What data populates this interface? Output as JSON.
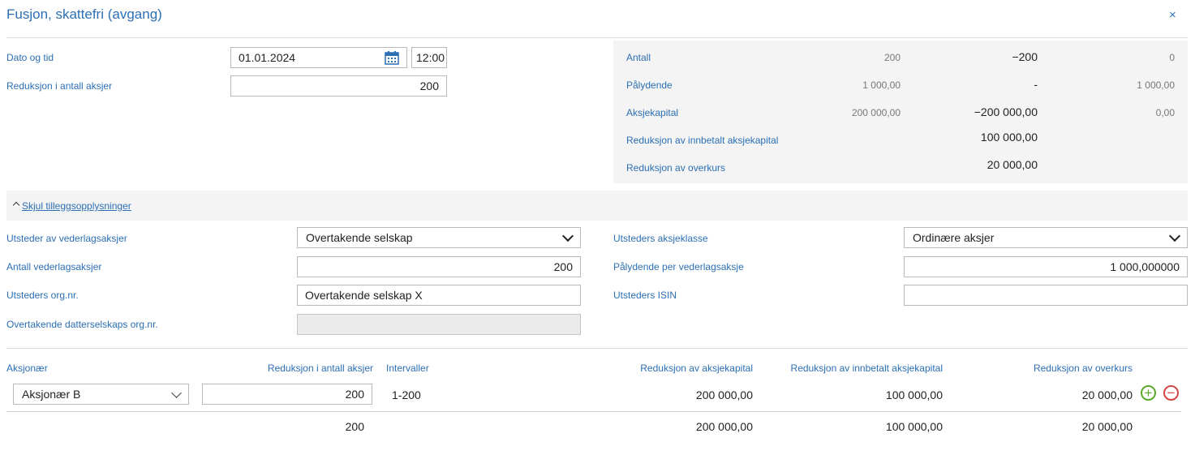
{
  "dialog": {
    "title": "Fusjon, skattefri (avgang)",
    "close_label": "×"
  },
  "form": {
    "date_time": {
      "label": "Dato og tid",
      "date": "01.01.2024",
      "time": "12:00"
    },
    "reduction_shares": {
      "label": "Reduksjon i antall aksjer",
      "value": "200"
    }
  },
  "summary": {
    "rows": [
      {
        "label": "Antall",
        "before": "200",
        "change": "−200",
        "after": "0"
      },
      {
        "label": "Pålydende",
        "before": "1 000,00",
        "change": "-",
        "after": "1 000,00"
      },
      {
        "label": "Aksjekapital",
        "before": "200 000,00",
        "change": "−200 000,00",
        "after": "0,00"
      },
      {
        "label": "Reduksjon av innbetalt aksjekapital",
        "before": "",
        "change": "100 000,00",
        "after": ""
      },
      {
        "label": "Reduksjon av overkurs",
        "before": "",
        "change": "20 000,00",
        "after": ""
      }
    ]
  },
  "toggle": {
    "label": "Skjul tilleggsopplysninger"
  },
  "extra": {
    "issuer": {
      "label": "Utsteder av vederlagsaksjer",
      "value": "Overtakende selskap"
    },
    "share_class": {
      "label": "Utsteders aksjeklasse",
      "value": "Ordinære aksjer"
    },
    "consideration_count": {
      "label": "Antall vederlagsaksjer",
      "value": "200"
    },
    "par_per_share": {
      "label": "Pålydende per vederlagsaksje",
      "value": "1 000,000000"
    },
    "issuer_org": {
      "label": "Utsteders org.nr.",
      "value": "Overtakende selskap X"
    },
    "issuer_isin": {
      "label": "Utsteders ISIN",
      "value": ""
    },
    "subsidiary_org": {
      "label": "Overtakende datterselskaps org.nr.",
      "value": ""
    }
  },
  "table": {
    "headers": {
      "shareholder": "Aksjonær",
      "reduction": "Reduksjon i antall aksjer",
      "intervals": "Intervaller",
      "capital": "Reduksjon av aksjekapital",
      "paid_in": "Reduksjon av innbetalt aksjekapital",
      "premium": "Reduksjon av overkurs"
    },
    "rows": [
      {
        "shareholder": "Aksjonær B",
        "reduction": "200",
        "intervals": "1-200",
        "capital": "200 000,00",
        "paid_in": "100 000,00",
        "premium": "20 000,00"
      }
    ],
    "totals": {
      "reduction": "200",
      "capital": "200 000,00",
      "paid_in": "100 000,00",
      "premium": "20 000,00"
    }
  },
  "icons": {
    "calendar": "calendar-icon",
    "add": "add-row-icon",
    "remove": "remove-row-icon",
    "collapse": "chevron-up-icon"
  },
  "colors": {
    "accent": "#2b6fb5",
    "add": "#5aaa2c",
    "remove": "#d64545",
    "panel": "#f4f4f4"
  }
}
